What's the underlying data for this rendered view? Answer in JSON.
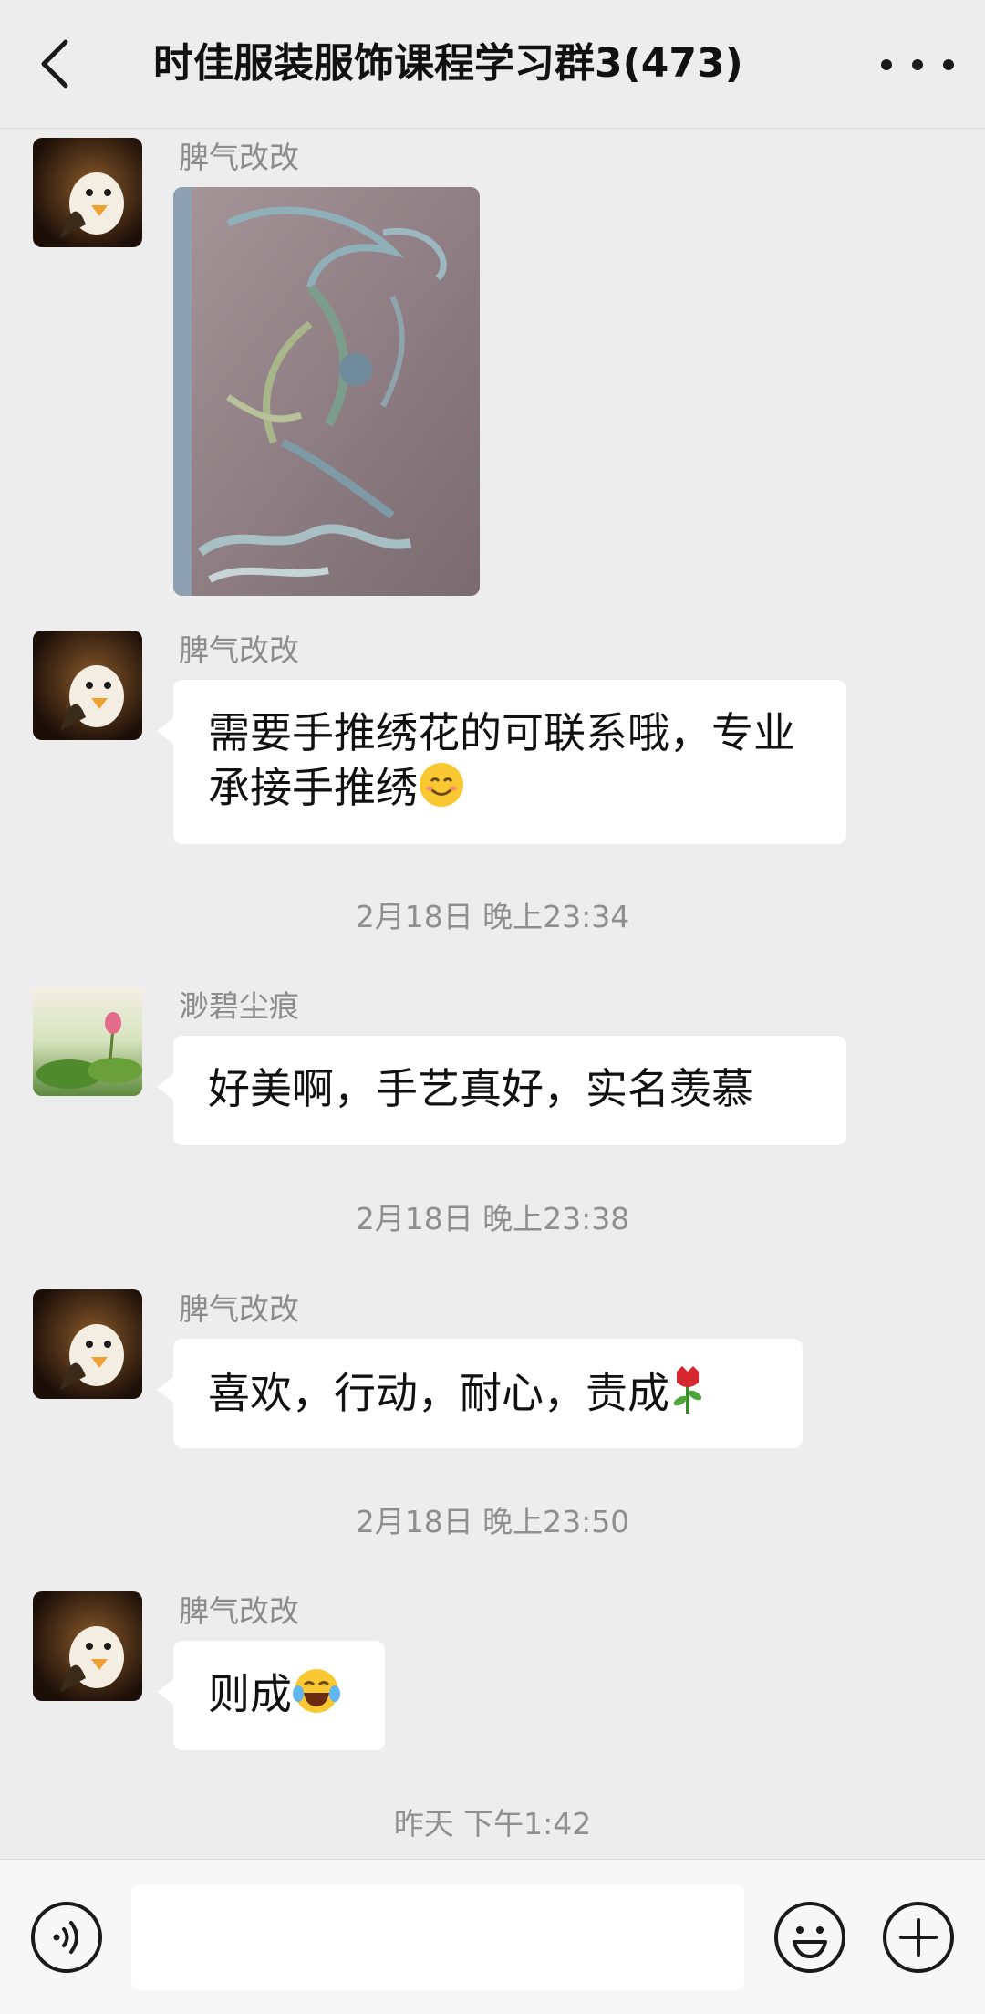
{
  "header": {
    "title": "时佳服装服饰课程学习群3(473)"
  },
  "messages": [
    {
      "sender": "脾气改改",
      "type": "image"
    },
    {
      "sender": "脾气改改",
      "text": "需要手推绣花的可联系哦，专业承接手推绣",
      "emoji": "smile-emoji"
    },
    {
      "timestamp": "2月18日 晚上23:34"
    },
    {
      "sender": "渺碧尘痕",
      "text": "好美啊，手艺真好，实名羡慕"
    },
    {
      "timestamp": "2月18日 晚上23:38"
    },
    {
      "sender": "脾气改改",
      "text": "喜欢，行动，耐心，责成",
      "emoji": "rose-emoji"
    },
    {
      "timestamp": "2月18日 晚上23:50"
    },
    {
      "sender": "脾气改改",
      "text": "则成",
      "emoji": "tears-of-joy-emoji"
    },
    {
      "timestamp": "昨天 下午1:42"
    }
  ],
  "input": {
    "value": "",
    "placeholder": ""
  },
  "colors": {
    "background": "#ededed",
    "bubble": "#ffffff",
    "sender_text": "#8c8c8c",
    "timestamp_text": "#8f8f8f"
  }
}
